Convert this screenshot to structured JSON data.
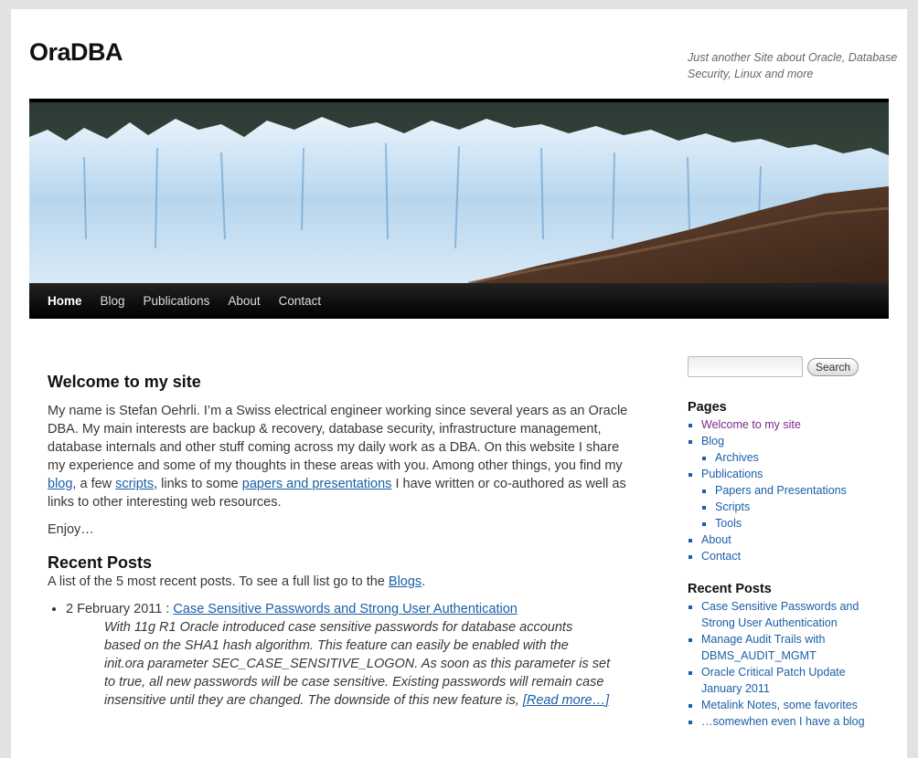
{
  "site": {
    "title": "OraDBA",
    "description": "Just another Site about Oracle, Database Security, Linux and more"
  },
  "nav": {
    "items": [
      "Home",
      "Blog",
      "Publications",
      "About",
      "Contact"
    ]
  },
  "main": {
    "heading": "Welcome to my site",
    "intro_part1": "My name is Stefan Oehrli. I’m a Swiss electrical engineer working since several years as an Oracle DBA. My main interests are backup & recovery, database security, infrastructure management, database internals and other stuff coming across my daily work as a DBA. On this website I share my experience and some of my thoughts in these areas with you. Among other things, you find my ",
    "intro_link1": "blog",
    "intro_part2": ", a few ",
    "intro_link2": "scripts",
    "intro_part3": ", links to some ",
    "intro_link3": "papers and presentations",
    "intro_part4": " I have written or co-authored as well as links to other interesting web resources.",
    "enjoy": "Enjoy…",
    "recent_heading": "Recent Posts",
    "recent_intro": "A list of the 5 most recent posts. To see a full list go to the ",
    "recent_intro_link": "Blogs",
    "recent_intro_end": ".",
    "posts": [
      {
        "date": "2 February 2011 : ",
        "title": "Case Sensitive Passwords and Strong User Authentication",
        "excerpt": "With 11g R1 Oracle introduced case sensitive passwords for database accounts based on the SHA1 hash algorithm. This feature can easily be enabled with the init.ora parameter SEC_CASE_SENSITIVE_LOGON. As soon as this parameter is set to true, all new passwords will be case sensitive. Existing passwords will remain case insensitive until they are changed. The downside of this new feature is, ",
        "more": "[Read more…]"
      }
    ]
  },
  "sidebar": {
    "search_label": "Search",
    "search_placeholder": "",
    "pages_heading": "Pages",
    "pages": {
      "welcome": "Welcome to my site",
      "blog": "Blog",
      "archives": "Archives",
      "publications": "Publications",
      "papers": "Papers and Presentations",
      "scripts": "Scripts",
      "tools": "Tools",
      "about": "About",
      "contact": "Contact"
    },
    "recent_heading": "Recent Posts",
    "recent": [
      "Case Sensitive Passwords and Strong User Authentication",
      "Manage Audit Trails with DBMS_AUDIT_MGMT",
      "Oracle Critical Patch Update January 2011",
      "Metalink Notes, some favorites",
      "…somewhen even I have a blog"
    ]
  },
  "colors": {
    "link": "#1b5fa8",
    "visited": "#7a2a8c",
    "nav_bg": "#000000"
  }
}
